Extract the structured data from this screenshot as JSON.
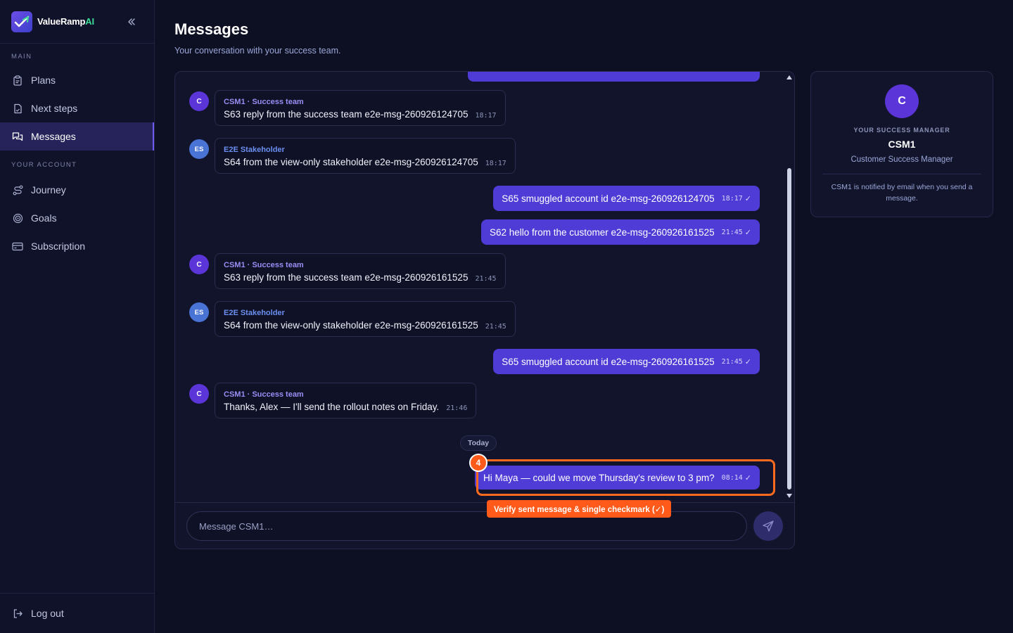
{
  "brand": {
    "name": "ValueRamp",
    "accent": "AI"
  },
  "sidebar": {
    "sections": [
      {
        "title": "MAIN",
        "items": [
          {
            "label": "Plans",
            "icon": "clipboard-icon"
          },
          {
            "label": "Next steps",
            "icon": "checklist-icon"
          },
          {
            "label": "Messages",
            "icon": "messages-icon",
            "active": true
          }
        ]
      },
      {
        "title": "YOUR ACCOUNT",
        "items": [
          {
            "label": "Journey",
            "icon": "route-icon"
          },
          {
            "label": "Goals",
            "icon": "target-icon"
          },
          {
            "label": "Subscription",
            "icon": "card-icon"
          }
        ]
      }
    ],
    "logout_label": "Log out"
  },
  "page": {
    "title": "Messages",
    "subtitle": "Your conversation with your success team."
  },
  "chat": {
    "messages": [
      {
        "dir": "in",
        "avatar": "C",
        "sender": "CSM1 · Success team",
        "text": "S63 reply from the success team e2e-msg-260926124705",
        "time": "18:17"
      },
      {
        "dir": "in",
        "avatar": "ES",
        "sender": "E2E Stakeholder",
        "text": "S64 from the view-only stakeholder e2e-msg-260926124705",
        "time": "18:17"
      },
      {
        "dir": "out",
        "text": "S65 smuggled account id e2e-msg-260926124705",
        "time": "18:17",
        "check": "✓"
      },
      {
        "dir": "out",
        "text": "S62 hello from the customer e2e-msg-260926161525",
        "time": "21:45",
        "check": "✓"
      },
      {
        "dir": "in",
        "avatar": "C",
        "sender": "CSM1 · Success team",
        "text": "S63 reply from the success team e2e-msg-260926161525",
        "time": "21:45"
      },
      {
        "dir": "in",
        "avatar": "ES",
        "sender": "E2E Stakeholder",
        "text": "S64 from the view-only stakeholder e2e-msg-260926161525",
        "time": "21:45"
      },
      {
        "dir": "out",
        "text": "S65 smuggled account id e2e-msg-260926161525",
        "time": "21:45",
        "check": "✓"
      },
      {
        "dir": "in",
        "avatar": "C",
        "sender": "CSM1 · Success team",
        "text": "Thanks, Alex — I'll send the rollout notes on Friday.",
        "time": "21:46"
      },
      {
        "dir": "out",
        "text": "Hi Maya — could we move Thursday's review to 3 pm?",
        "time": "08:14",
        "check": "✓"
      }
    ],
    "day_separator": "Today",
    "annotation": {
      "step": "4",
      "label": "Verify sent message & single checkmark (✓)"
    },
    "input_placeholder": "Message CSM1…"
  },
  "manager": {
    "avatar": "C",
    "label": "YOUR SUCCESS MANAGER",
    "name": "CSM1",
    "role": "Customer Success Manager",
    "note": "CSM1 is notified by email when you send a message."
  },
  "colors": {
    "background": "#0d0f22",
    "accent": "#4f3bd6",
    "brand_accent": "#3ddc97",
    "highlight": "#ff5a1a"
  }
}
